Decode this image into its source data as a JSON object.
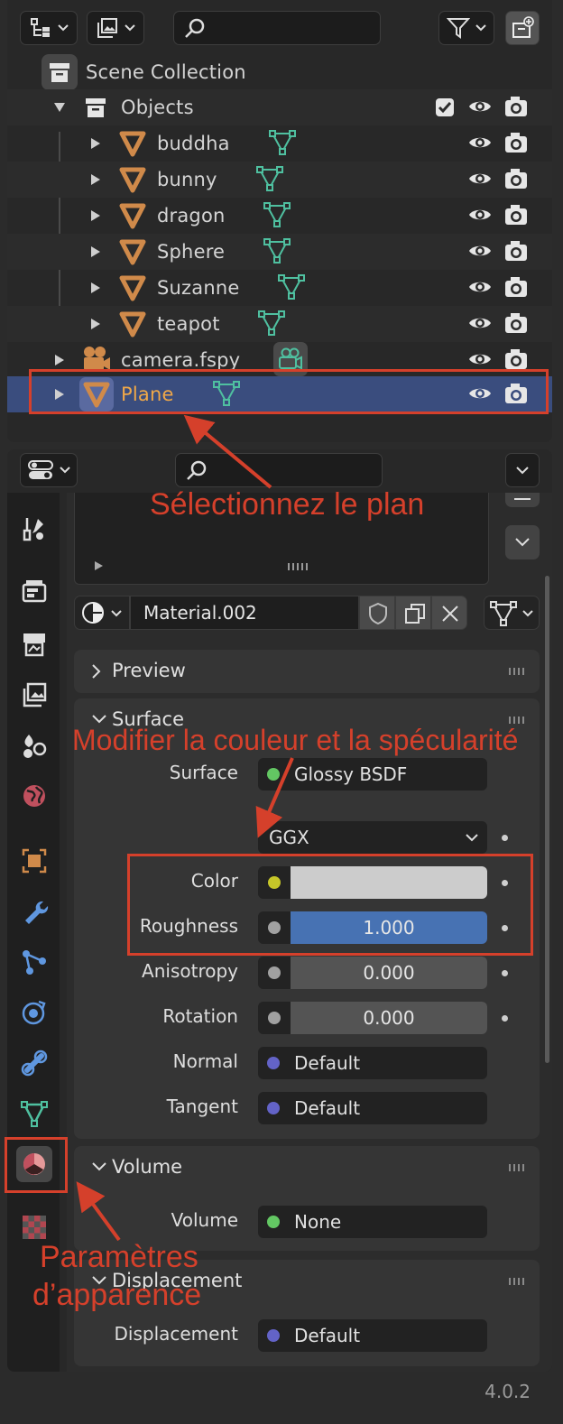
{
  "outliner": {
    "search_placeholder": "",
    "scene_collection": "Scene Collection",
    "objects_label": "Objects",
    "children": [
      "buddha",
      "bunny",
      "dragon",
      "Sphere",
      "Suzanne",
      "teapot"
    ],
    "camera_label": "camera.fspy",
    "plane_label": "Plane"
  },
  "properties": {
    "material_name": "Material.002",
    "preview_label": "Preview",
    "surface_panel": "Surface",
    "surface_label": "Surface",
    "surface_value": "Glossy BSDF",
    "distribution": "GGX",
    "color_label": "Color",
    "roughness_label": "Roughness",
    "roughness_value": "1.000",
    "anisotropy_label": "Anisotropy",
    "anisotropy_value": "0.000",
    "rotation_label": "Rotation",
    "rotation_value": "0.000",
    "normal_label": "Normal",
    "normal_value": "Default",
    "tangent_label": "Tangent",
    "tangent_value": "Default",
    "volume_panel": "Volume",
    "volume_label": "Volume",
    "volume_value": "None",
    "displacement_panel": "Displacement",
    "displacement_label": "Displacement",
    "displacement_value": "Default"
  },
  "annotations": {
    "select_plane": "Sélectionnez le plan",
    "modify_color": "Modifier la couleur et la spécularité",
    "appearance_1": "Paramètres",
    "appearance_2": "d’apparence"
  },
  "version": "4.0.2",
  "colors": {
    "mesh_orange": "#d08a4a",
    "mesh_data_teal": "#4fc0a0",
    "selection": "#3a4d7e",
    "annotation_red": "#d5402b",
    "socket_green": "#63c763",
    "socket_yellow": "#c7c729",
    "socket_grey": "#a1a1a1",
    "socket_violet": "#6363c7",
    "roughness_bar": "#4772b3"
  }
}
